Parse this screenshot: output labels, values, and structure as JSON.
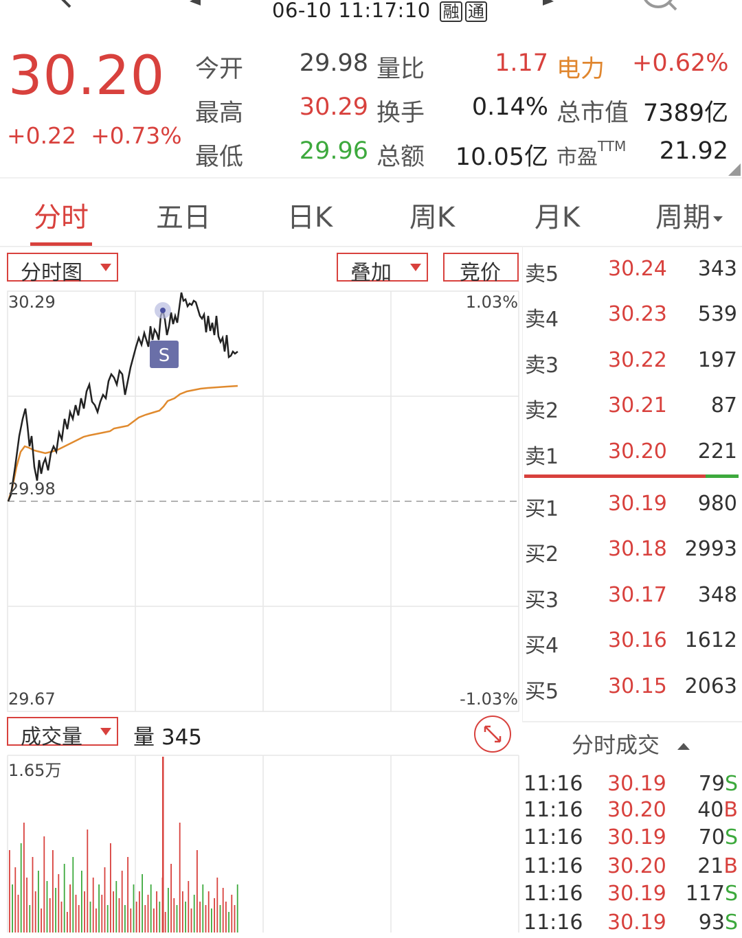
{
  "header": {
    "timestamp": "06-10 11:17:10",
    "tag_margin": "融",
    "tag_connect": "通"
  },
  "quote": {
    "price": "30.20",
    "change": "+0.22  +0.73%",
    "rows": [
      {
        "l1": "今开",
        "v1": "29.98",
        "l2": "量比",
        "v2": "1.17",
        "l3": "电力",
        "v3": "+0.62%"
      },
      {
        "l1": "最高",
        "v1": "30.29",
        "l2": "换手",
        "v2": "0.14%",
        "l3": "总市值",
        "v3": "7389亿"
      },
      {
        "l1": "最低",
        "v1": "29.96",
        "l2": "总额",
        "v2": "10.05亿",
        "l3": "市盈",
        "l3sup": "TTM",
        "v3": "21.92"
      }
    ]
  },
  "tabs": [
    "分时",
    "五日",
    "日K",
    "周K",
    "月K",
    "周期"
  ],
  "chart_controls": {
    "mode": "分时图",
    "overlay": "叠加",
    "auction": "竞价"
  },
  "intraday": {
    "high_label": "30.29",
    "low_label": "29.67",
    "open_label": "29.98",
    "pct_high": "1.03%",
    "pct_low": "-1.03%",
    "marker": "S"
  },
  "volume_panel": {
    "mode": "成交量",
    "volume_text": "量 345",
    "max_label": "1.65万"
  },
  "order_book": {
    "asks": [
      {
        "label": "卖5",
        "price": "30.24",
        "vol": "343"
      },
      {
        "label": "卖4",
        "price": "30.23",
        "vol": "539"
      },
      {
        "label": "卖3",
        "price": "30.22",
        "vol": "197"
      },
      {
        "label": "卖2",
        "price": "30.21",
        "vol": "87"
      },
      {
        "label": "卖1",
        "price": "30.20",
        "vol": "221"
      }
    ],
    "bids": [
      {
        "label": "买1",
        "price": "30.19",
        "vol": "980"
      },
      {
        "label": "买2",
        "price": "30.18",
        "vol": "2993"
      },
      {
        "label": "买3",
        "price": "30.17",
        "vol": "348"
      },
      {
        "label": "买4",
        "price": "30.16",
        "vol": "1612"
      },
      {
        "label": "买5",
        "price": "30.15",
        "vol": "2063"
      }
    ]
  },
  "trades": {
    "title": "分时成交",
    "rows": [
      {
        "time": "11:16",
        "price": "30.19",
        "vol": "79",
        "side": "S"
      },
      {
        "time": "11:16",
        "price": "30.20",
        "vol": "40",
        "side": "B"
      },
      {
        "time": "11:16",
        "price": "30.19",
        "vol": "70",
        "side": "S"
      },
      {
        "time": "11:16",
        "price": "30.20",
        "vol": "21",
        "side": "B"
      },
      {
        "time": "11:16",
        "price": "30.19",
        "vol": "117",
        "side": "S"
      },
      {
        "time": "11:16",
        "price": "30.19",
        "vol": "93",
        "side": "S"
      }
    ]
  },
  "colors": {
    "up": "#d8413d",
    "down": "#3da93d",
    "avg_line": "#e08a2e",
    "price_line": "#222222",
    "marker_bg": "#6a6fa8"
  }
}
